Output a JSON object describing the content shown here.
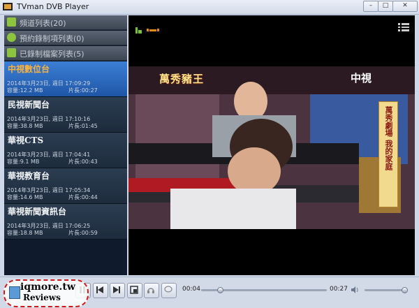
{
  "window": {
    "title": "TVman DVB Player"
  },
  "sidebar": {
    "sections": [
      {
        "label": "頻道列表(20)",
        "icon": "tv-icon"
      },
      {
        "label": "預約錄制項列表(0)",
        "icon": "clock-icon"
      },
      {
        "label": "已錄制檔案列表(5)",
        "icon": "list-icon"
      }
    ],
    "recordings": [
      {
        "channel": "中視數位台",
        "datetime": "2014年3月23日, 週日 17:09:29",
        "size": "容量:12.2 MB",
        "duration": "片長:00:27",
        "selected": true
      },
      {
        "channel": "民視新聞台",
        "datetime": "2014年3月23日, 週日 17:10:16",
        "size": "容量:38.8 MB",
        "duration": "片長:01:45",
        "selected": false
      },
      {
        "channel": "華視CTS",
        "datetime": "2014年3月23日, 週日 17:04:41",
        "size": "容量:9.1 MB",
        "duration": "片長:00:43",
        "selected": false
      },
      {
        "channel": "華視教育台",
        "datetime": "2014年3月23日, 週日 17:05:34",
        "size": "容量:14.6 MB",
        "duration": "片長:00:44",
        "selected": false
      },
      {
        "channel": "華視新聞資訊台",
        "datetime": "2014年3月23日, 週日 17:06:25",
        "size": "容量:18.8 MB",
        "duration": "片長:00:59",
        "selected": false
      }
    ]
  },
  "video": {
    "show_title": "萬秀豬王",
    "channel_logo": "中視",
    "side_banner": "萬秀劇場 我的家庭"
  },
  "controls": {
    "current_time": "00:04",
    "total_time": "00:27",
    "progress": 0.15,
    "volume": 0.95
  },
  "watermark": {
    "line1": "iqmore.tw",
    "line2": "Reviews"
  },
  "colors": {
    "selected_channel": "#ffb23a",
    "selected_row": "#2f6cc4",
    "sidebar_bg": "#0f1b2c"
  }
}
